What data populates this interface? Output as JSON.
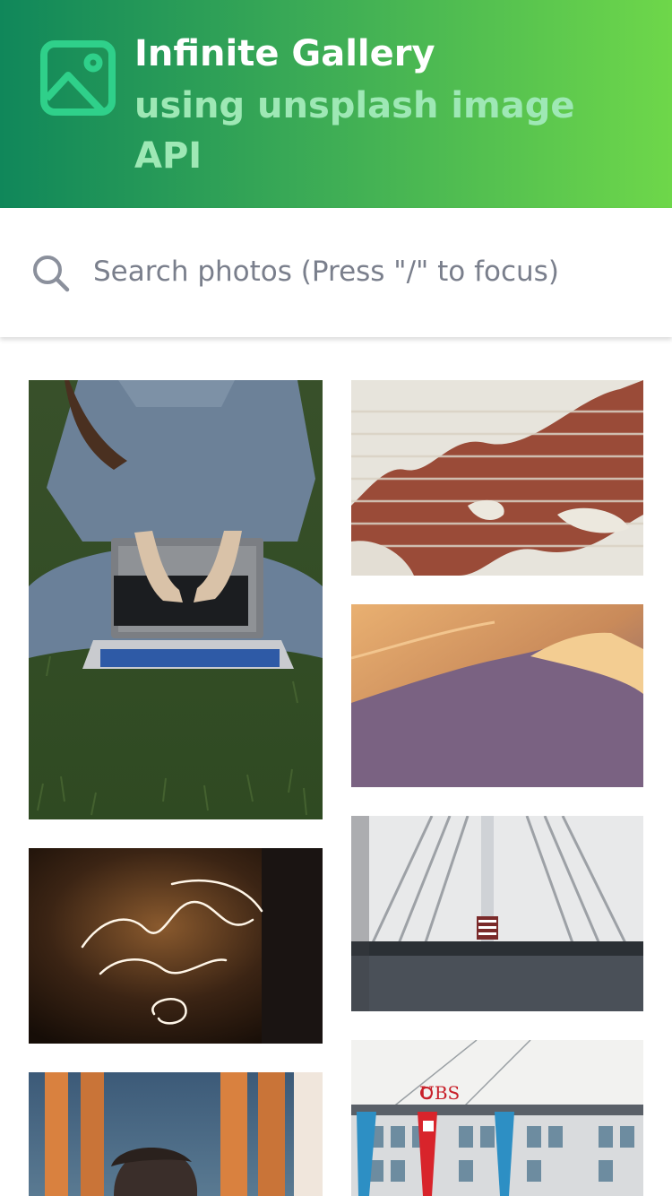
{
  "header": {
    "title": "Infinite Gallery",
    "subtitle": "using unsplash image API",
    "logo_icon": "image-icon",
    "gradient": [
      "#10875a",
      "#6ed74a"
    ]
  },
  "search": {
    "placeholder": "Search photos (Press \"/\" to focus)",
    "value": "",
    "icon": "search-icon"
  },
  "gallery": {
    "photos": [
      {
        "subject": "woman typing on laptop on grass"
      },
      {
        "subject": "cracked plaster over brick wall"
      },
      {
        "subject": "sand dunes at sunset"
      },
      {
        "subject": "neon sign 'where is my love?!'"
      },
      {
        "subject": "white ribbed station interior with flag"
      },
      {
        "subject": "woman in cap looking up between pillars"
      },
      {
        "subject": "UBS building with flags"
      }
    ],
    "neon_text": "where is my love?!",
    "building_sign": "UBS"
  }
}
